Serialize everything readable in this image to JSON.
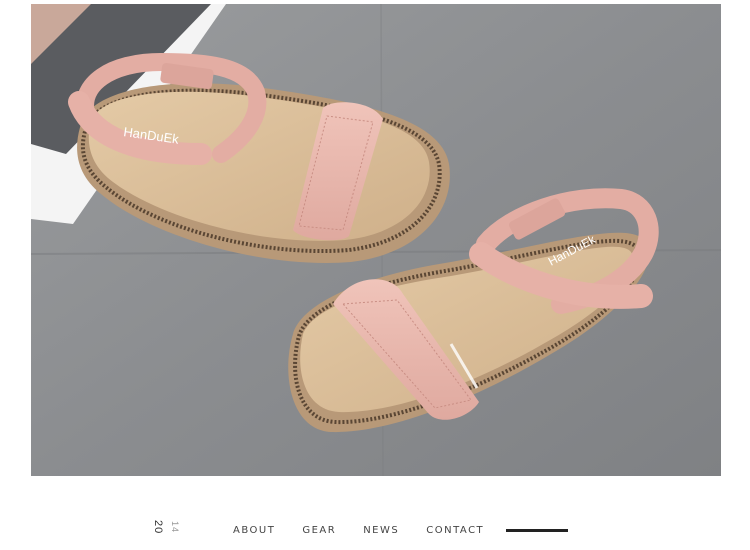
{
  "photo": {
    "subject": "two-pink-suede-strap-sandals",
    "brand_print_left": "HanDuEk",
    "brand_print_right": "HanDuEk",
    "colors": {
      "concrete": "#8d8f91",
      "suede_pink": "#e9b7ad",
      "footbed": "#d9bd96",
      "sole_cork": "#b89978",
      "sole_dark": "#6b5642"
    }
  },
  "nav": {
    "year_main": "20",
    "year_sub": "14",
    "items": [
      {
        "label": "ABOUT"
      },
      {
        "label": "GEAR"
      },
      {
        "label": "NEWS"
      },
      {
        "label": "CONTACT"
      }
    ]
  }
}
